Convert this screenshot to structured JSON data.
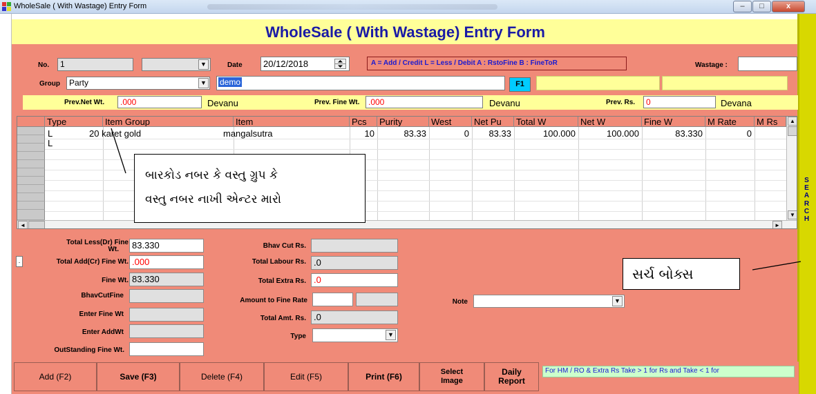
{
  "window": {
    "title": "WholeSale ( With Wastage) Entry Form",
    "minimize_glyph": "–",
    "maximize_glyph": "□",
    "close_glyph": "x"
  },
  "header": {
    "title": "WholeSale ( With Wastage) Entry Form"
  },
  "form": {
    "no_label": "No.",
    "no_value": "1",
    "date_label": "Date",
    "date_value": "20/12/2018",
    "legend": "A = Add / Credit   L = Less / Debit  A : RstoFine   B : FineToR",
    "wastage_label": "Wastage :",
    "wastage_value": "",
    "group_label": "Group",
    "group_value": "Party",
    "party_value": "demo",
    "f1_label": "F1"
  },
  "prev": {
    "net_label": "Prev.Net Wt.",
    "net_value": ".000",
    "net_unit": "Devanu",
    "fine_label": "Prev. Fine Wt.",
    "fine_value": ".000",
    "fine_unit": "Devanu",
    "rs_label": "Prev. Rs.",
    "rs_value": "0",
    "rs_unit": "Devana"
  },
  "grid": {
    "columns": [
      "Type",
      "Item Group",
      "Item",
      "Pcs",
      "Purity",
      "West",
      "Net Pu",
      "Total W",
      "Net W",
      "Fine W",
      "M Rate",
      "M Rs"
    ],
    "rows": [
      {
        "type": "L",
        "item_group": "20 karet gold",
        "item": "mangalsutra",
        "pcs": "10",
        "purity": "83.33",
        "west": "0",
        "net_pu": "83.33",
        "total_w": "100.000",
        "net_w": "100.000",
        "fine_w": "83.330",
        "m_rate": "0"
      },
      {
        "type": "L",
        "item_group": "",
        "item": "",
        "pcs": "",
        "purity": "",
        "west": "",
        "net_pu": "",
        "total_w": "",
        "net_w": "",
        "fine_w": "",
        "m_rate": ""
      }
    ],
    "scroll_up": "▲",
    "scroll_down": "▼",
    "scroll_left": "◄",
    "scroll_right": "►"
  },
  "annotations": {
    "grid_hint_line1": "બારકોડ નબર કે વસ્તુ ગ્રુપ કે",
    "grid_hint_line2": "વસ્તુ નબર નાખી એન્ટર મારો",
    "search_box": "સર્ચ બોક્સ"
  },
  "sidebar": {
    "search_letters": [
      "S",
      "E",
      "A",
      "R",
      "C",
      "H"
    ]
  },
  "totals": {
    "total_less_label": "Total Less(Dr) Fine",
    "total_less_label2": "Wt.",
    "total_less_value": "83.330",
    "total_add_label": "Total Add(Cr) Fine Wt.",
    "total_add_value": ".000",
    "fine_wt_label": "Fine Wt.",
    "fine_wt_value": "83.330",
    "bhavcutfine_label": "BhavCutFine",
    "enter_fine_label": "Enter Fine Wt",
    "enter_add_label": "Enter AddWt",
    "outstanding_label": "OutStanding Fine Wt.",
    "bhav_cut_rs_label": "Bhav Cut Rs.",
    "total_labour_label": "Total Labour Rs.",
    "total_labour_value": ".0",
    "total_extra_label": "Total Extra Rs.",
    "total_extra_value": ".0",
    "amount_fine_rate_label": "Amount to Fine Rate",
    "total_amt_label": "Total Amt. Rs.",
    "total_amt_value": ".0",
    "type_label": "Type",
    "note_label": "Note"
  },
  "buttons": {
    "add": "Add (F2)",
    "save": "Save (F3)",
    "delete": "Delete (F4)",
    "edit": "Edit (F5)",
    "print": "Print (F6)",
    "select_image_1": "Select",
    "select_image_2": "Image",
    "daily_report_1": "Daily",
    "daily_report_2": "Report",
    "small_left": "."
  },
  "hint": "For HM / RO & Extra Rs Take > 1 for Rs and  Take < 1 for",
  "colors": {
    "form_bg": "#f08a78",
    "header_bg": "#ffff99",
    "title_text": "#1a1aa6",
    "sidebar": "#d8d800"
  },
  "icons": [
    "app-icon",
    "dropdown-arrow-icon",
    "spin-icon"
  ]
}
